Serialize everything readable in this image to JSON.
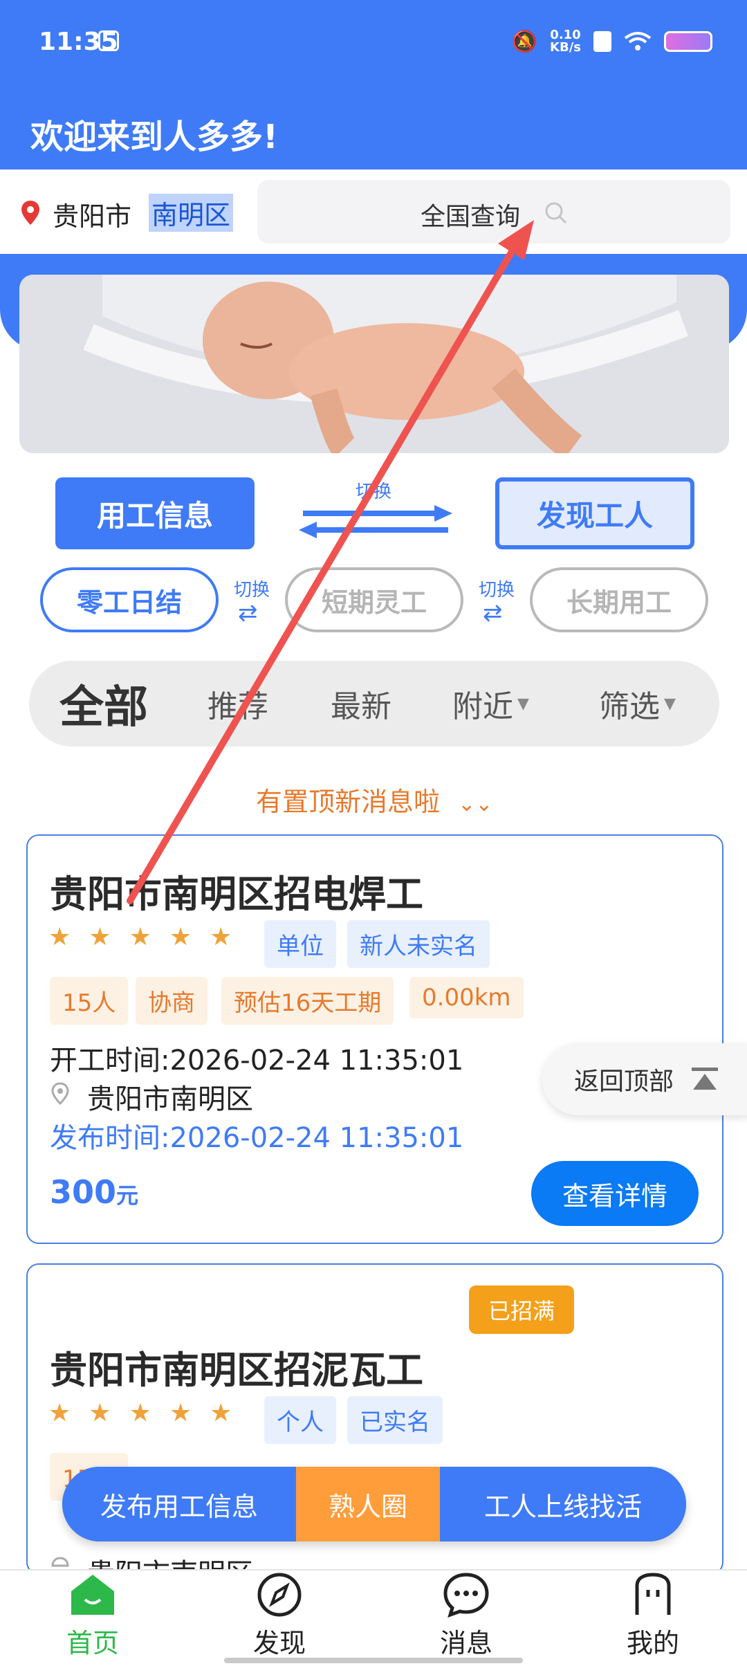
{
  "status_bar": {
    "time": "11:35",
    "net_speed": "0.10",
    "net_unit": "KB/s"
  },
  "header": {
    "greeting": "欢迎来到人多多!"
  },
  "location": {
    "city": "贵阳市",
    "district": "南明区"
  },
  "search": {
    "label": "全国查询"
  },
  "mode_toggle": {
    "left": "用工信息",
    "right": "发现工人",
    "switch_label": "切换"
  },
  "job_type": {
    "items": [
      "零工日结",
      "短期灵工",
      "长期用工"
    ],
    "switch_label": "切换",
    "active": "零工日结"
  },
  "filter_tabs": {
    "items": [
      "全部",
      "推荐",
      "最新",
      "附近",
      "筛选"
    ],
    "active": "全部"
  },
  "pinned_notice": "有置顶新消息啦",
  "jobs": [
    {
      "title": "贵阳市南明区招电焊工",
      "rating": 5,
      "tags": [
        "单位",
        "新人未实名"
      ],
      "attrs": [
        "15人",
        "协商",
        "预估16天工期",
        "0.00km"
      ],
      "start_time_label": "开工时间:",
      "start_time": "2026-02-24 11:35:01",
      "address": "贵阳市南明区",
      "publish_time_label": "发布时间:",
      "publish_time": "2026-02-24 11:35:01",
      "price": "300",
      "price_unit": "元",
      "detail_button": "查看详情"
    },
    {
      "title": "贵阳市南明区招泥瓦工",
      "rating": 5,
      "badge": "已招满",
      "tags": [
        "个人",
        "已实名"
      ],
      "attrs_visible": [
        "15人"
      ],
      "address": "贵阳市南明区"
    }
  ],
  "back_to_top": "返回顶部",
  "fab": {
    "post_job": "发布用工信息",
    "circle": "熟人圈",
    "find_work": "工人上线找活"
  },
  "bottom_nav": [
    {
      "label": "首页",
      "icon": "home-icon",
      "active": true
    },
    {
      "label": "发现",
      "icon": "compass-icon"
    },
    {
      "label": "消息",
      "icon": "chat-icon"
    },
    {
      "label": "我的",
      "icon": "profile-icon"
    }
  ],
  "colors": {
    "primary": "#3f7bf6",
    "orange": "#e8792b",
    "active_nav": "#2db84a",
    "badge": "#f4a01a",
    "fab_circle": "#ff9d3b"
  }
}
